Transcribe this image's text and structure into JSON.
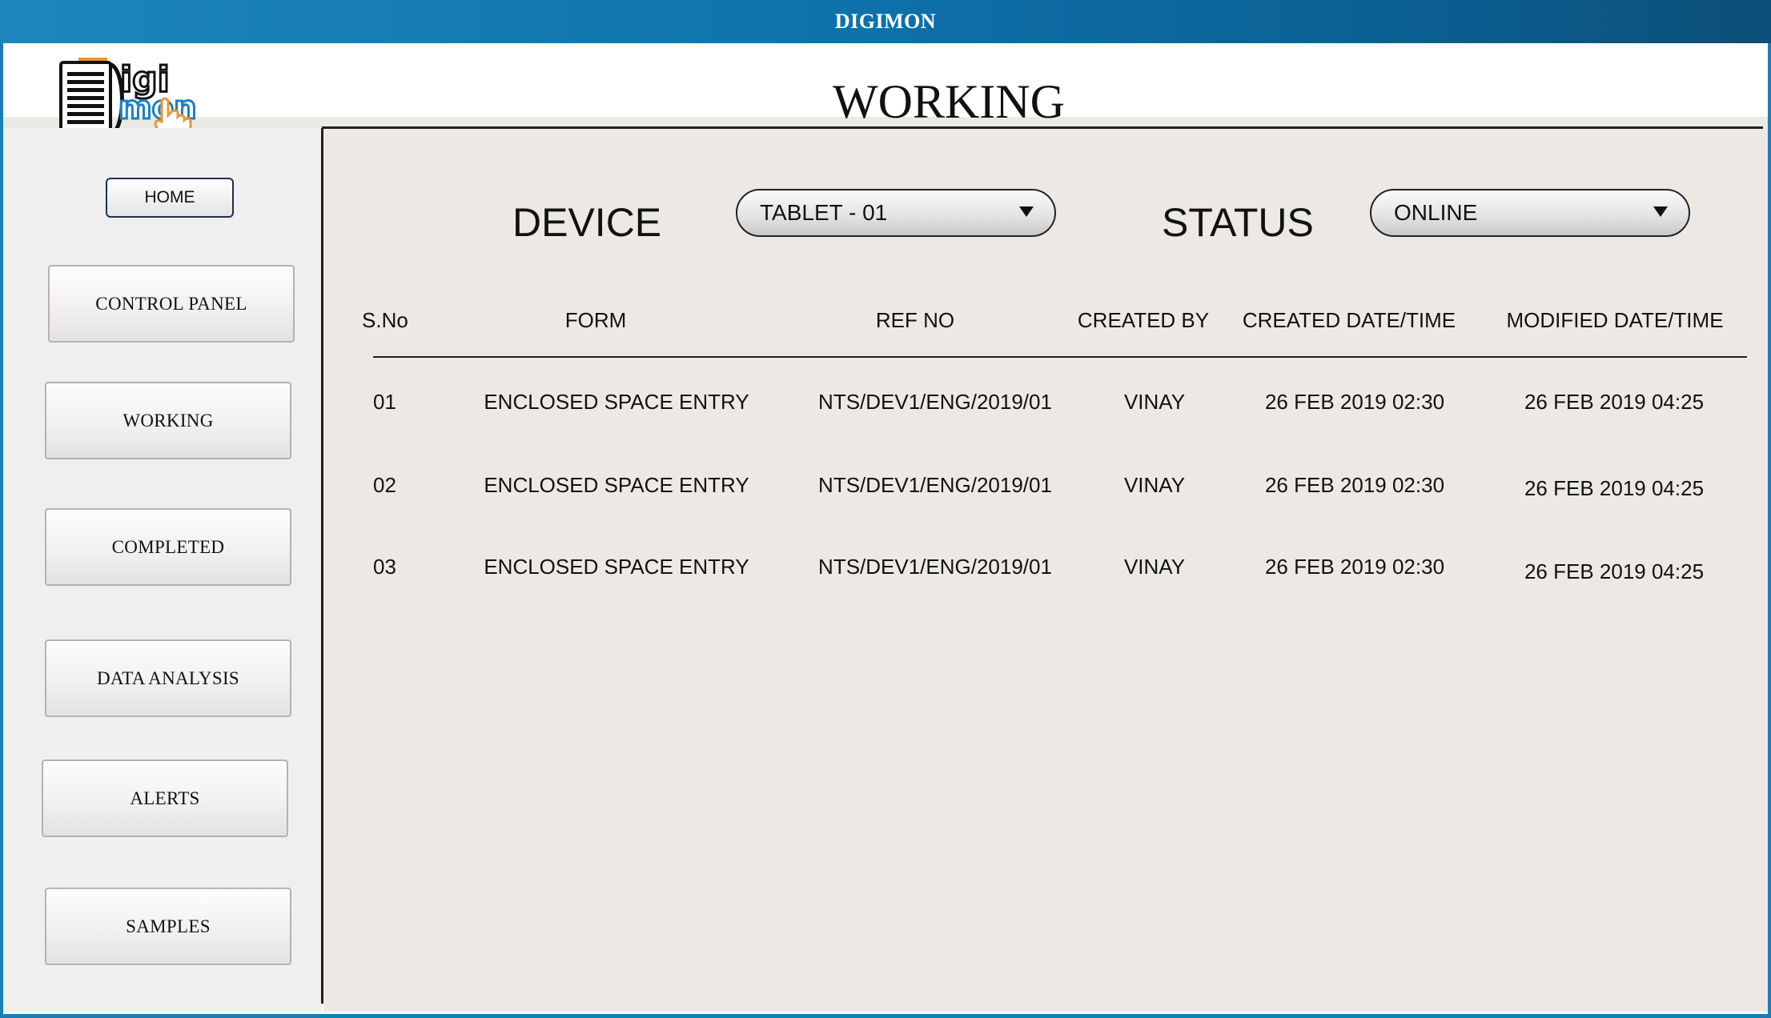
{
  "window": {
    "title": "DIGIMON"
  },
  "page": {
    "title": "WORKING"
  },
  "logo": {
    "line1": "igi",
    "line2": "mon"
  },
  "sidebar": {
    "home_label": "HOME",
    "items": [
      {
        "label": "CONTROL PANEL"
      },
      {
        "label": "WORKING"
      },
      {
        "label": "COMPLETED"
      },
      {
        "label": "DATA ANALYSIS"
      },
      {
        "label": "ALERTS"
      },
      {
        "label": "SAMPLES"
      }
    ]
  },
  "filters": {
    "device_label": "DEVICE",
    "device_value": "TABLET - 01",
    "status_label": "STATUS",
    "status_value": "ONLINE"
  },
  "table": {
    "headers": [
      "S.No",
      "FORM",
      "REF NO",
      "CREATED BY",
      "CREATED DATE/TIME",
      "MODIFIED DATE/TIME"
    ],
    "rows": [
      [
        "01",
        "ENCLOSED SPACE ENTRY",
        "NTS/DEV1/ENG/2019/01",
        "VINAY",
        "26 FEB 2019 02:30",
        "26 FEB 2019 04:25"
      ],
      [
        "02",
        "ENCLOSED SPACE ENTRY",
        "NTS/DEV1/ENG/2019/01",
        "VINAY",
        "26 FEB 2019 02:30",
        "26 FEB 2019 04:25"
      ],
      [
        "03",
        "ENCLOSED SPACE ENTRY",
        "NTS/DEV1/ENG/2019/01",
        "VINAY",
        "26 FEB 2019 02:30",
        "26 FEB 2019 04:25"
      ]
    ]
  },
  "colors": {
    "title_bar": "#0f73ad",
    "frame": "#1a7fb8",
    "panel_bg": "#ece9e4",
    "sidebar_bg": "#efefef",
    "logo_blue": "#1c7fc4",
    "logo_orange": "#e8962f"
  }
}
